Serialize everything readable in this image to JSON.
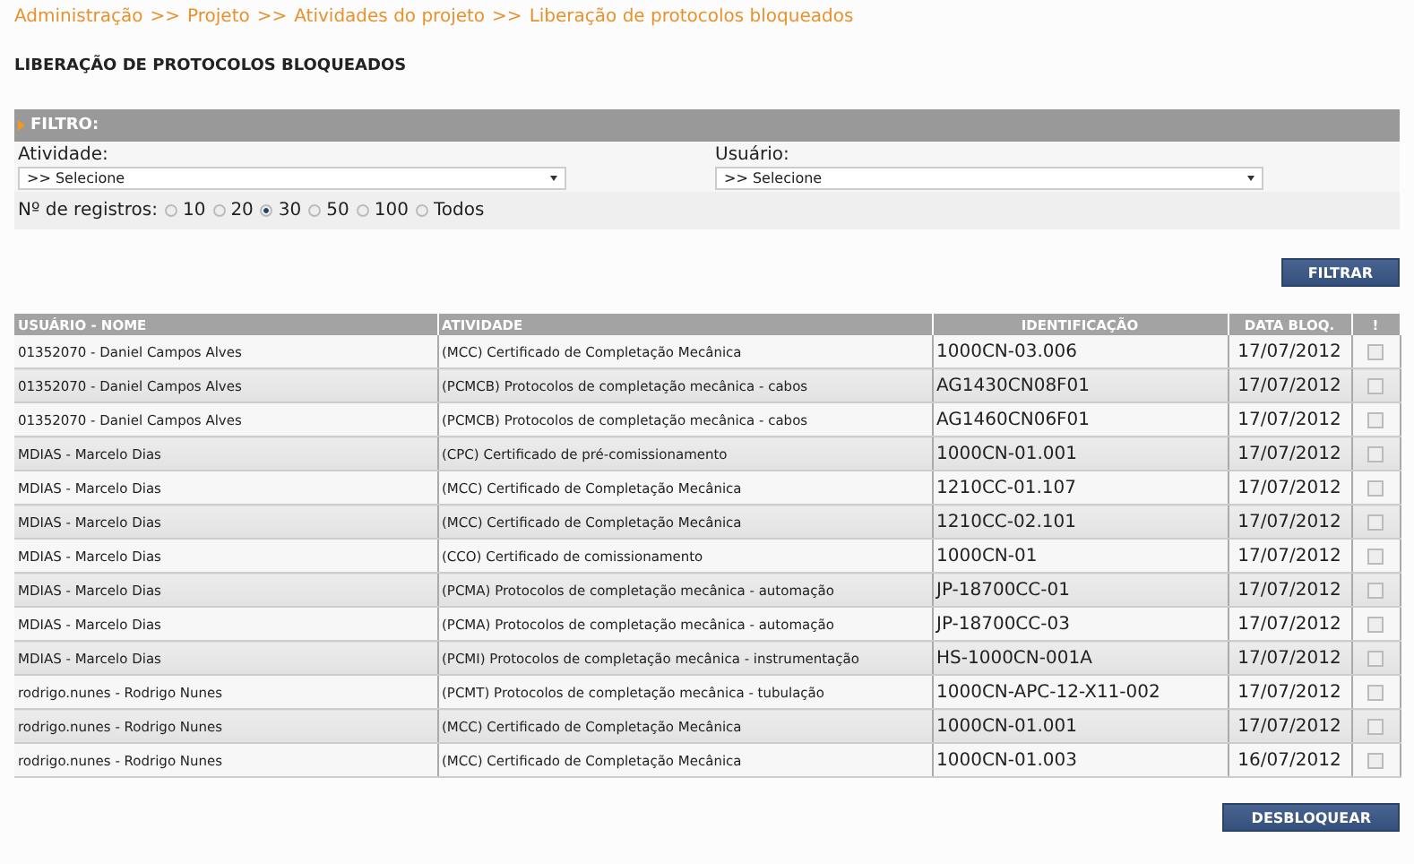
{
  "breadcrumb": [
    "Administração",
    ">>",
    "Projeto",
    ">>",
    "Atividades do projeto",
    ">>",
    "Liberação de protocolos bloqueados"
  ],
  "title": "LIBERAÇÃO DE PROTOCOLOS BLOQUEADOS",
  "filter": {
    "title": "FILTRO:",
    "fields": [
      {
        "label": "Atividade:",
        "value": ">> Selecione"
      },
      {
        "label": "Usuário:",
        "value": ">> Selecione"
      }
    ],
    "records_label": "Nº de registros:",
    "records_options": [
      {
        "label": "10",
        "selected": false
      },
      {
        "label": "20",
        "selected": false
      },
      {
        "label": "30",
        "selected": true
      },
      {
        "label": "50",
        "selected": false
      },
      {
        "label": "100",
        "selected": false
      },
      {
        "label": "Todos",
        "selected": false
      }
    ],
    "button": "FILTRAR"
  },
  "table": {
    "columns": [
      "USUÁRIO - NOME",
      "ATIVIDADE",
      "IDENTIFICAÇÃO",
      "DATA BLOQ.",
      "!"
    ],
    "rows": [
      {
        "user": "01352070 - Daniel Campos Alves",
        "activity": "(MCC) Certificado de Completação Mecânica",
        "id": "1000CN-03.006",
        "date": "17/07/2012",
        "checked": false
      },
      {
        "user": "01352070 - Daniel Campos Alves",
        "activity": "(PCMCB) Protocolos de completação mecânica - cabos",
        "id": "AG1430CN08F01",
        "date": "17/07/2012",
        "checked": false
      },
      {
        "user": "01352070 - Daniel Campos Alves",
        "activity": "(PCMCB) Protocolos de completação mecânica - cabos",
        "id": "AG1460CN06F01",
        "date": "17/07/2012",
        "checked": false
      },
      {
        "user": "MDIAS - Marcelo Dias",
        "activity": "(CPC) Certificado de pré-comissionamento",
        "id": "1000CN-01.001",
        "date": "17/07/2012",
        "checked": false
      },
      {
        "user": "MDIAS - Marcelo Dias",
        "activity": "(MCC) Certificado de Completação Mecânica",
        "id": "1210CC-01.107",
        "date": "17/07/2012",
        "checked": false
      },
      {
        "user": "MDIAS - Marcelo Dias",
        "activity": "(MCC) Certificado de Completação Mecânica",
        "id": "1210CC-02.101",
        "date": "17/07/2012",
        "checked": false
      },
      {
        "user": "MDIAS - Marcelo Dias",
        "activity": "(CCO) Certificado de comissionamento",
        "id": "1000CN-01",
        "date": "17/07/2012",
        "checked": false
      },
      {
        "user": "MDIAS - Marcelo Dias",
        "activity": "(PCMA) Protocolos de completação mecânica - automação",
        "id": "JP-18700CC-01",
        "date": "17/07/2012",
        "checked": false
      },
      {
        "user": "MDIAS - Marcelo Dias",
        "activity": "(PCMA) Protocolos de completação mecânica - automação",
        "id": "JP-18700CC-03",
        "date": "17/07/2012",
        "checked": false
      },
      {
        "user": "MDIAS - Marcelo Dias",
        "activity": "(PCMI) Protocolos de completação mecânica - instrumentação",
        "id": "HS-1000CN-001A",
        "date": "17/07/2012",
        "checked": false
      },
      {
        "user": "rodrigo.nunes - Rodrigo Nunes",
        "activity": "(PCMT) Protocolos de completação mecânica - tubulação",
        "id": "1000CN-APC-12-X11-002",
        "date": "17/07/2012",
        "checked": false
      },
      {
        "user": "rodrigo.nunes - Rodrigo Nunes",
        "activity": "(MCC) Certificado de Completação Mecânica",
        "id": "1000CN-01.001",
        "date": "17/07/2012",
        "checked": false
      },
      {
        "user": "rodrigo.nunes - Rodrigo Nunes",
        "activity": "(MCC) Certificado de Completação Mecânica",
        "id": "1000CN-01.003",
        "date": "16/07/2012",
        "checked": false
      }
    ]
  },
  "button": "DESBLOQUEAR"
}
